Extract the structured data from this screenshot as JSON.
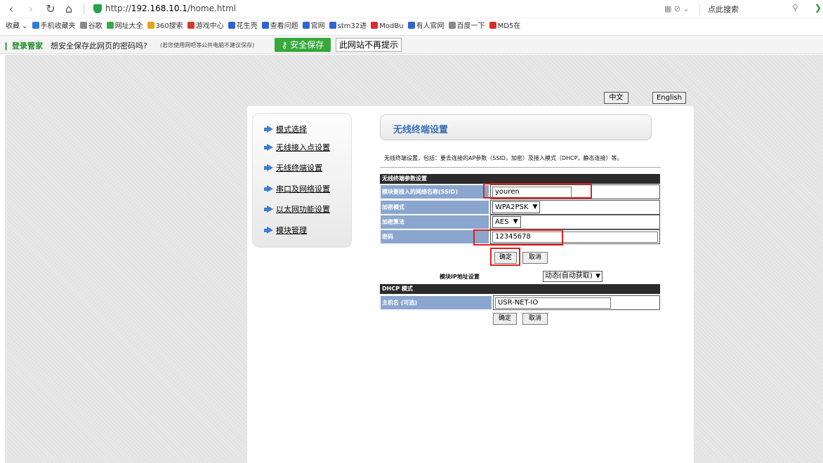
{
  "browser": {
    "url_prefix": "http://",
    "url_host": "192.168.10.1",
    "url_path": "/home.html",
    "right_icons": "▦ ⊘ ⌄",
    "search_placeholder": "点此搜索"
  },
  "bookmarks": [
    {
      "label": "收藏 ⌄",
      "color": ""
    },
    {
      "label": "手机收藏夹",
      "color": "#2d7fd6"
    },
    {
      "label": "谷歌",
      "color": "#888888"
    },
    {
      "label": "网址大全",
      "color": "#3aa84b"
    },
    {
      "label": "360搜索",
      "color": "#e8a21a"
    },
    {
      "label": "游戏中心",
      "color": "#d33c2b"
    },
    {
      "label": "花生壳",
      "color": "#2d64d6"
    },
    {
      "label": "查看问题",
      "color": "#2d64d6"
    },
    {
      "label": "官网",
      "color": "#2d64d6"
    },
    {
      "label": "stm32进",
      "color": "#2d64d6"
    },
    {
      "label": "ModBu",
      "color": "#d62d2d"
    },
    {
      "label": "有人官网",
      "color": "#2d64d6"
    },
    {
      "label": "百度一下",
      "color": "#888888"
    },
    {
      "label": "MD5在",
      "color": "#d62d2d"
    }
  ],
  "password_bar": {
    "brand": "登录管家",
    "question": "想安全保存此网页的密码吗?",
    "note": "(若您使用网吧等公共电脑不建议保存)",
    "save_label": "安全保存",
    "never_label": "此网站不再提示"
  },
  "lang": {
    "cn": "中文",
    "en": "English"
  },
  "menu": [
    "模式选择",
    "无线接入点设置",
    "无线终端设置",
    "串口及网络设置",
    "以太网功能设置",
    "模块管理"
  ],
  "page": {
    "title": "无线终端设置",
    "description": "无线终端设置，包括：要去连接的AP参数（SSID，加密）及接入模式（DHCP，静态连接）等。"
  },
  "wifi_form": {
    "section_title": "无线终端参数设置",
    "ssid_label": "模块要接入的网络名称(SSID)",
    "ssid_value": "youren",
    "encrypt_mode_label": "加密模式",
    "encrypt_mode_value": "WPA2PSK",
    "encrypt_algo_label": "加密算法",
    "encrypt_algo_value": "AES",
    "password_label": "密码",
    "password_value": "12345678",
    "ok_label": "确定",
    "cancel_label": "取消"
  },
  "ip_form": {
    "ip_label": "模块IP地址设置",
    "ip_mode_value": "动态(自动获取)",
    "section_title": "DHCP 模式",
    "hostname_label": "主机名 (可选)",
    "hostname_value": "USR-NET-IO",
    "ok_label": "确定",
    "cancel_label": "取消"
  },
  "colors": {
    "accent_blue": "#3a70b8",
    "label_cell": "#8aa6cf",
    "highlight_red": "#e02020",
    "save_green": "#38a83b"
  }
}
